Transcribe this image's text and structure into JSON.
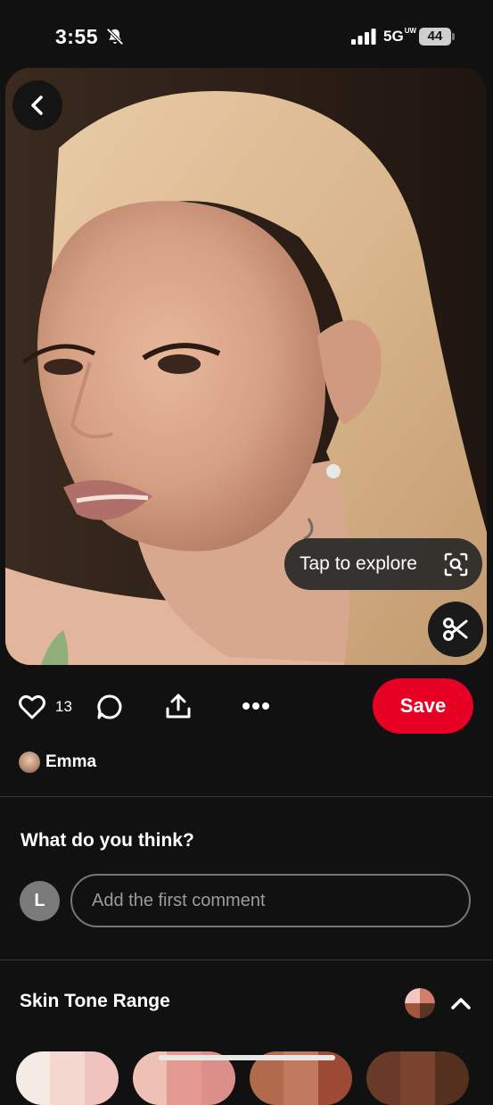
{
  "status": {
    "time": "3:55",
    "network": "5G",
    "network_badge": "UW",
    "battery": "44"
  },
  "pin": {
    "explore_label": "Tap to explore",
    "like_count": "13",
    "save_label": "Save",
    "creator_name": "Emma"
  },
  "comments": {
    "prompt": "What do you think?",
    "user_initial": "L",
    "placeholder": "Add the first comment"
  },
  "skin_tone": {
    "title": "Skin Tone Range",
    "indicator_colors": [
      "#f1c7c0",
      "#d27e6c",
      "#a1563d",
      "#5a3424"
    ],
    "swatch_colors": [
      [
        "#f6ebe4",
        "#f4d8d0",
        "#f0c3bf"
      ],
      [
        "#efc1b4",
        "#e49a90",
        "#dc8f89"
      ],
      [
        "#b16a4c",
        "#c27a5f",
        "#9d4a36"
      ],
      [
        "#6a3a28",
        "#7a4330",
        "#55301f"
      ]
    ]
  },
  "colors": {
    "save": "#e60023",
    "background": "#111111"
  }
}
